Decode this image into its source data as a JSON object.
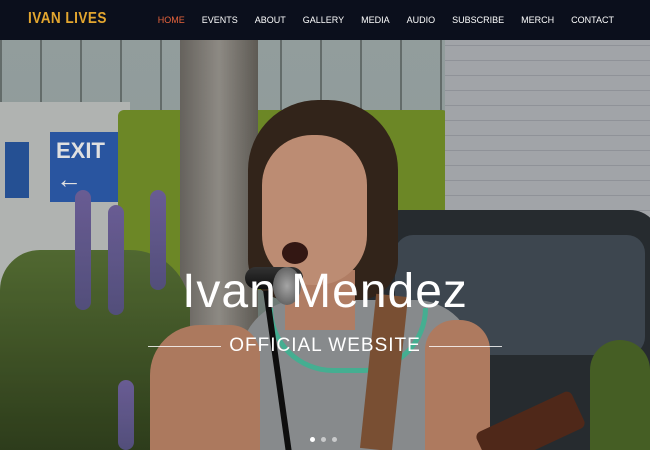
{
  "brand": {
    "logo_text": "IVAN LIVES",
    "accent": "#e3a62f"
  },
  "nav": {
    "active_color": "#e8643c",
    "items": [
      {
        "label": "HOME",
        "active": true
      },
      {
        "label": "EVENTS"
      },
      {
        "label": "ABOUT"
      },
      {
        "label": "GALLERY"
      },
      {
        "label": "MEDIA"
      },
      {
        "label": "AUDIO"
      },
      {
        "label": "SUBSCRIBE"
      },
      {
        "label": "MERCH"
      },
      {
        "label": "CONTACT"
      }
    ]
  },
  "hero": {
    "title": "Ivan Mendez",
    "subtitle": "OFFICIAL WEBSITE",
    "sign_text": "EXIT",
    "slides": 3,
    "active_slide": 1
  }
}
